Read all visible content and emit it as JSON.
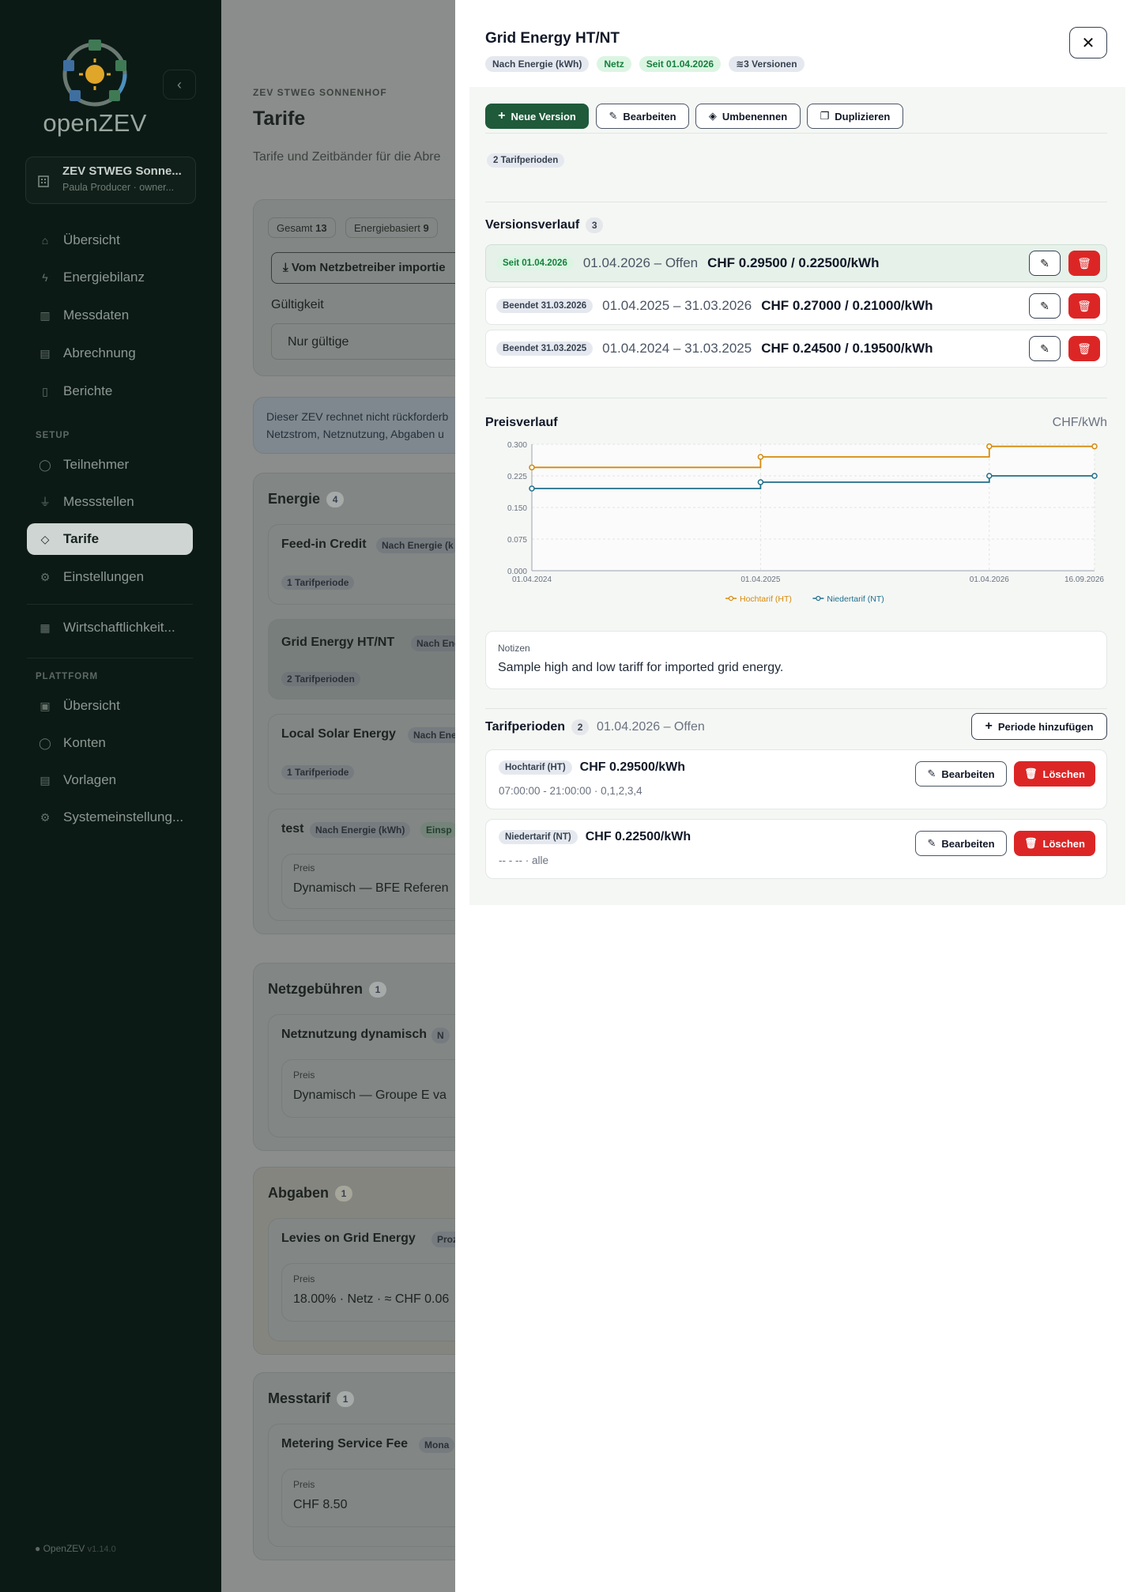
{
  "sidebar": {
    "logo_text": "openZEV",
    "org_name": "ZEV STWEG Sonne...",
    "org_sub": "Paula Producer · owner...",
    "nav_main": [
      {
        "label": "Übersicht",
        "icon": "home-icon"
      },
      {
        "label": "Energiebilanz",
        "icon": "bolt-icon"
      },
      {
        "label": "Messdaten",
        "icon": "bar-chart-icon"
      },
      {
        "label": "Abrechnung",
        "icon": "receipt-icon"
      },
      {
        "label": "Berichte",
        "icon": "document-icon"
      }
    ],
    "setup_label": "SETUP",
    "nav_setup": [
      {
        "label": "Teilnehmer",
        "icon": "user-icon"
      },
      {
        "label": "Messstellen",
        "icon": "plug-icon"
      },
      {
        "label": "Tarife",
        "icon": "tag-icon",
        "active": true
      },
      {
        "label": "Einstellungen",
        "icon": "gear-icon"
      }
    ],
    "wirtschaft_label": "Wirtschaftlichkeit...",
    "platform_label": "PLATTFORM",
    "nav_platform": [
      {
        "label": "Übersicht",
        "icon": "dashboard-icon"
      },
      {
        "label": "Konten",
        "icon": "users-icon"
      },
      {
        "label": "Vorlagen",
        "icon": "template-icon"
      },
      {
        "label": "Systemeinstellung...",
        "icon": "settings-icon"
      }
    ],
    "footer_name": "OpenZEV",
    "footer_version": "v1.14.0"
  },
  "main": {
    "overline": "ZEV STWEG SONNENHOF",
    "title": "Tarife",
    "subtitle": "Tarife und Zeitbänder für die Abre",
    "stats": [
      {
        "label": "Gesamt",
        "value": "13"
      },
      {
        "label": "Energiebasiert",
        "value": "9"
      }
    ],
    "import_button": "Vom Netzbetreiber importie",
    "validity_label": "Gültigkeit",
    "validity_value": "Nur gültige",
    "info_line1": "Dieser ZEV rechnet nicht rückforderb",
    "info_line2": "Netzstrom, Netznutzung, Abgaben u",
    "groups": {
      "energie": {
        "title": "Energie",
        "count": "4"
      },
      "netz": {
        "title": "Netzgebühren",
        "count": "1"
      },
      "abgaben": {
        "title": "Abgaben",
        "count": "1"
      },
      "mess": {
        "title": "Messtarif",
        "count": "1"
      }
    },
    "tariffs": {
      "feed": {
        "name": "Feed-in Credit",
        "badge": "Nach Energie (k",
        "periods": "1 Tarifperiode"
      },
      "grid": {
        "name": "Grid Energy HT/NT",
        "badge": "Nach Ene",
        "periods": "2 Tarifperioden"
      },
      "solar": {
        "name": "Local Solar Energy",
        "badge": "Nach Ene",
        "periods": "1 Tarifperiode"
      },
      "test": {
        "name": "test",
        "badge": "Nach Energie (kWh)",
        "badge2": "Einsp",
        "price_label": "Preis",
        "price": "Dynamisch — BFE Referen"
      },
      "netznutzung": {
        "name": "Netznutzung dynamisch",
        "badge": "N",
        "price_label": "Preis",
        "price": "Dynamisch — Groupe E va"
      },
      "levies": {
        "name": "Levies on Grid Energy",
        "badge": "Proze",
        "price_label": "Preis",
        "price": "18.00% · Netz · ≈ CHF 0.06"
      },
      "metering": {
        "name": "Metering Service Fee",
        "badge": "Mona",
        "price_label": "Preis",
        "price": "CHF 8.50"
      }
    }
  },
  "panel": {
    "title": "Grid Energy HT/NT",
    "badges": {
      "basis": "Nach Energie (kWh)",
      "category": "Netz",
      "since": "Seit 01.04.2026",
      "versions": "3 Versionen"
    },
    "buttons": {
      "new_version": "Neue Version",
      "edit": "Bearbeiten",
      "rename": "Umbenennen",
      "duplicate": "Duplizieren"
    },
    "period_count_badge": "2 Tarifperioden",
    "history_title": "Versionsverlauf",
    "history_count": "3",
    "versions": [
      {
        "status": "Seit 01.04.2026",
        "range": "01.04.2026 – Offen",
        "price": "CHF 0.29500 / 0.22500/kWh"
      },
      {
        "status": "Beendet 31.03.2026",
        "range": "01.04.2025 – 31.03.2026",
        "price": "CHF 0.27000 / 0.21000/kWh"
      },
      {
        "status": "Beendet 31.03.2025",
        "range": "01.04.2024 – 31.03.2025",
        "price": "CHF 0.24500 / 0.19500/kWh"
      }
    ],
    "chart_title": "Preisverlauf",
    "chart_unit": "CHF/kWh",
    "notes_label": "Notizen",
    "notes_text": "Sample high and low tariff for imported grid energy.",
    "periods_title": "Tarifperioden",
    "periods_count": "2",
    "periods_range": "01.04.2026 – Offen",
    "add_period": "Periode hinzufügen",
    "periods": [
      {
        "name": "Hochtarif (HT)",
        "price": "CHF 0.29500/kWh",
        "detail": "07:00:00 - 21:00:00 · 0,1,2,3,4"
      },
      {
        "name": "Niedertarif (NT)",
        "price": "CHF 0.22500/kWh",
        "detail": "-- - -- · alle"
      }
    ],
    "period_edit": "Bearbeiten",
    "period_delete": "Löschen"
  },
  "chart_data": {
    "type": "line",
    "title": "Preisverlauf",
    "ylabel": "CHF/kWh",
    "x": [
      "01.04.2024",
      "01.04.2025",
      "01.04.2026",
      "16.09.2026"
    ],
    "x_ticks": [
      "01.04.2024",
      "01.04.2025",
      "01.04.2026",
      "16.09.2026"
    ],
    "y_ticks": [
      "0.000",
      "0.075",
      "0.150",
      "0.225",
      "0.300"
    ],
    "ylim": [
      0,
      0.3
    ],
    "step": true,
    "grid": true,
    "legend_position": "bottom",
    "series": [
      {
        "name": "Hochtarif (HT)",
        "color": "#d68a0c",
        "values": [
          0.245,
          0.27,
          0.295,
          0.295
        ]
      },
      {
        "name": "Niedertarif (NT)",
        "color": "#1f6f8b",
        "values": [
          0.195,
          0.21,
          0.225,
          0.225
        ]
      }
    ]
  },
  "colors": {
    "accent": "#1f5a3a",
    "danger": "#dc2626",
    "success_bg": "#dcf5e3"
  }
}
